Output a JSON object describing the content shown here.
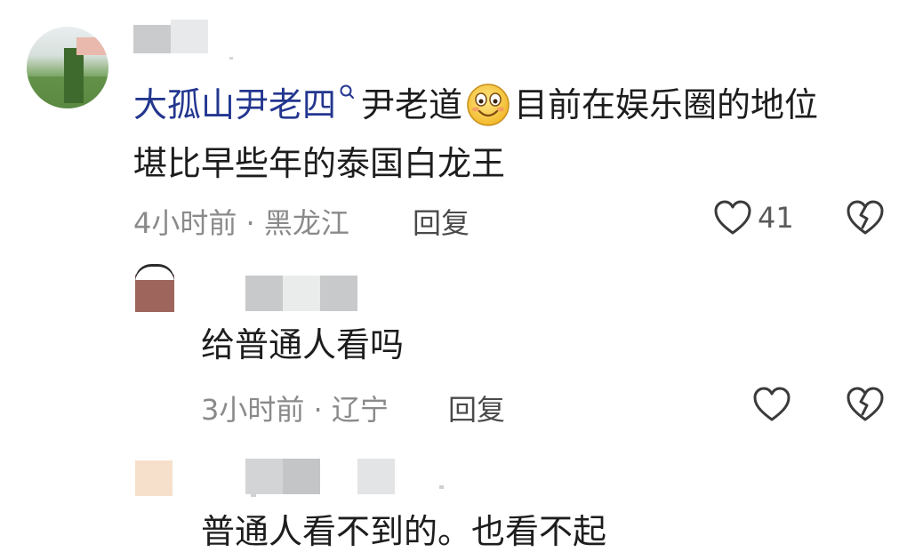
{
  "comments": [
    {
      "mention": "大孤山尹老四",
      "text_part1": "尹老道",
      "emoji": "smiling-face-emoji",
      "text_part2": "目前在娱乐圈的地位",
      "line2": "堪比早些年的泰国白龙王",
      "time": "4小时前",
      "separator": "·",
      "location": "黑龙江",
      "reply_label": "回复",
      "like_count": "41"
    },
    {
      "text": "给普通人看吗",
      "time": "3小时前",
      "separator": "·",
      "location": "辽宁",
      "reply_label": "回复"
    },
    {
      "text": "普通人看不到的。也看不起"
    }
  ],
  "colors": {
    "mention": "#23368f",
    "meta": "#8a8a8a",
    "text": "#1d1d1d"
  },
  "icons": [
    "heart-outline-icon",
    "broken-heart-icon",
    "mention-link-icon"
  ]
}
